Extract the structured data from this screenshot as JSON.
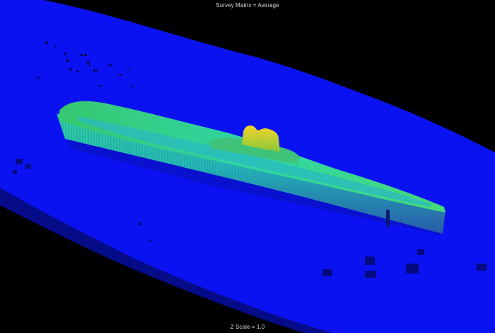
{
  "viewer": {
    "top_label": "Survey Matrix = Average",
    "bottom_label": "Z Scale = 1.0"
  },
  "colors": {
    "background": "#000000",
    "seafloor": "#0a10f0",
    "seafloor_dark": "#0810c8",
    "hull_side_high": "#2fb7a8",
    "hull_side_low": "#2c5ea8",
    "deck_green": "#3ed57a",
    "deck_cyan": "#2ec6c0",
    "conning_tower": "#e7c41e"
  },
  "icons": {
    "scene": "sonar-bathymetry-3d-view"
  }
}
